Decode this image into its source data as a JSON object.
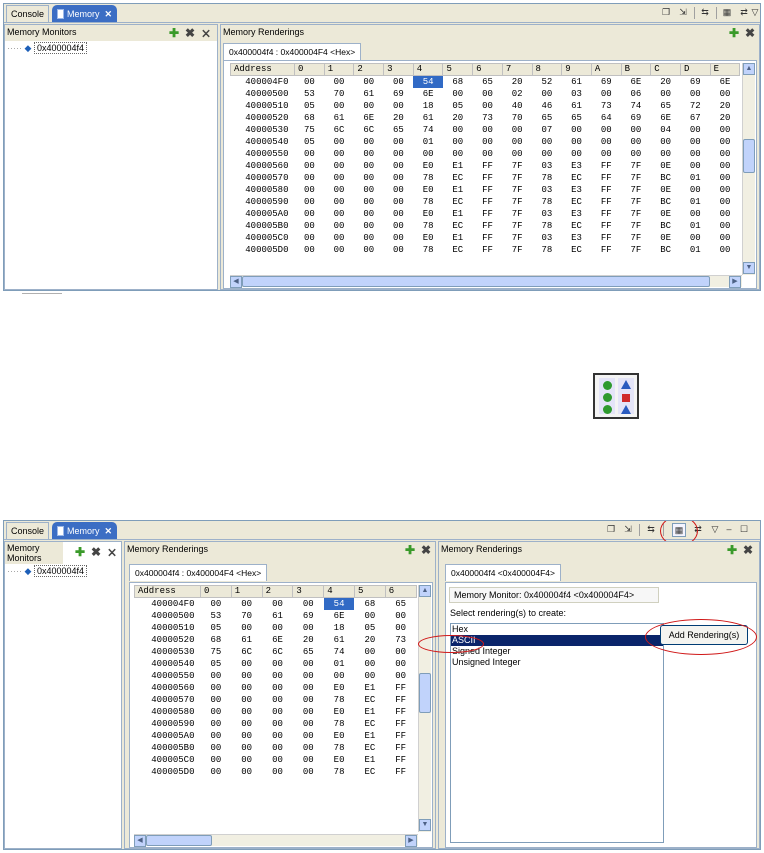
{
  "tabs": {
    "console": "Console",
    "memory": "Memory",
    "close": "✕"
  },
  "icons": {
    "toolbar": [
      "new-tab-icon",
      "import-icon",
      "link-icon",
      "toggle-split-pane-icon",
      "swap-icon",
      "view-menu-icon",
      "minimize-icon",
      "maximize-icon"
    ],
    "plus": "✚",
    "remove": "✖",
    "remove_all": "⨯"
  },
  "memory_monitors": {
    "title": "Memory Monitors",
    "title_wrapped": "Memory Monitors",
    "items": [
      "0x400004f4"
    ]
  },
  "renderings": {
    "title": "Memory Renderings",
    "tab_label": "0x400004f4 : 0x400004F4 <Hex>",
    "right_tab_label": "0x400004f4 <0x400004F4>"
  },
  "memory_table": {
    "address_header": "Address",
    "columns": [
      "0",
      "1",
      "2",
      "3",
      "4",
      "5",
      "6",
      "7",
      "8",
      "9",
      "A",
      "B",
      "C",
      "D",
      "E"
    ],
    "highlight": {
      "row": 0,
      "col": 4
    },
    "rows": [
      {
        "addr": "400004F0",
        "bytes": [
          "00",
          "00",
          "00",
          "00",
          "54",
          "68",
          "65",
          "20",
          "52",
          "61",
          "69",
          "6E",
          "20",
          "69",
          "6E"
        ]
      },
      {
        "addr": "40000500",
        "bytes": [
          "53",
          "70",
          "61",
          "69",
          "6E",
          "00",
          "00",
          "02",
          "00",
          "03",
          "00",
          "06",
          "00",
          "00",
          "00"
        ]
      },
      {
        "addr": "40000510",
        "bytes": [
          "05",
          "00",
          "00",
          "00",
          "18",
          "05",
          "00",
          "40",
          "46",
          "61",
          "73",
          "74",
          "65",
          "72",
          "20"
        ]
      },
      {
        "addr": "40000520",
        "bytes": [
          "68",
          "61",
          "6E",
          "20",
          "61",
          "20",
          "73",
          "70",
          "65",
          "65",
          "64",
          "69",
          "6E",
          "67",
          "20"
        ]
      },
      {
        "addr": "40000530",
        "bytes": [
          "75",
          "6C",
          "6C",
          "65",
          "74",
          "00",
          "00",
          "00",
          "07",
          "00",
          "00",
          "00",
          "04",
          "00",
          "00"
        ]
      },
      {
        "addr": "40000540",
        "bytes": [
          "05",
          "00",
          "00",
          "00",
          "01",
          "00",
          "00",
          "00",
          "00",
          "00",
          "00",
          "00",
          "00",
          "00",
          "00"
        ]
      },
      {
        "addr": "40000550",
        "bytes": [
          "00",
          "00",
          "00",
          "00",
          "00",
          "00",
          "00",
          "00",
          "00",
          "00",
          "00",
          "00",
          "00",
          "00",
          "00"
        ]
      },
      {
        "addr": "40000560",
        "bytes": [
          "00",
          "00",
          "00",
          "00",
          "E0",
          "E1",
          "FF",
          "7F",
          "03",
          "E3",
          "FF",
          "7F",
          "0E",
          "00",
          "00"
        ]
      },
      {
        "addr": "40000570",
        "bytes": [
          "00",
          "00",
          "00",
          "00",
          "78",
          "EC",
          "FF",
          "7F",
          "78",
          "EC",
          "FF",
          "7F",
          "BC",
          "01",
          "00"
        ]
      },
      {
        "addr": "40000580",
        "bytes": [
          "00",
          "00",
          "00",
          "00",
          "E0",
          "E1",
          "FF",
          "7F",
          "03",
          "E3",
          "FF",
          "7F",
          "0E",
          "00",
          "00"
        ]
      },
      {
        "addr": "40000590",
        "bytes": [
          "00",
          "00",
          "00",
          "00",
          "78",
          "EC",
          "FF",
          "7F",
          "78",
          "EC",
          "FF",
          "7F",
          "BC",
          "01",
          "00"
        ]
      },
      {
        "addr": "400005A0",
        "bytes": [
          "00",
          "00",
          "00",
          "00",
          "E0",
          "E1",
          "FF",
          "7F",
          "03",
          "E3",
          "FF",
          "7F",
          "0E",
          "00",
          "00"
        ]
      },
      {
        "addr": "400005B0",
        "bytes": [
          "00",
          "00",
          "00",
          "00",
          "78",
          "EC",
          "FF",
          "7F",
          "78",
          "EC",
          "FF",
          "7F",
          "BC",
          "01",
          "00"
        ]
      },
      {
        "addr": "400005C0",
        "bytes": [
          "00",
          "00",
          "00",
          "00",
          "E0",
          "E1",
          "FF",
          "7F",
          "03",
          "E3",
          "FF",
          "7F",
          "0E",
          "00",
          "00"
        ]
      },
      {
        "addr": "400005D0",
        "bytes": [
          "00",
          "00",
          "00",
          "00",
          "78",
          "EC",
          "FF",
          "7F",
          "78",
          "EC",
          "FF",
          "7F",
          "BC",
          "01",
          "00"
        ]
      }
    ]
  },
  "new_rendering": {
    "monitor_label": "Memory Monitor: 0x400004f4 <0x400004F4>",
    "prompt": "Select rendering(s) to create:",
    "options": [
      "Hex",
      "ASCII",
      "Signed Integer",
      "Unsigned Integer"
    ],
    "selected_index": 1,
    "add_button": "Add Rendering(s)"
  },
  "colors": {
    "active_tab": "#3c6ec4",
    "selection": "#316ac5",
    "list_selection": "#0a246a",
    "highlight_ring": "#d01818",
    "add_green": "#3a9a2a"
  }
}
